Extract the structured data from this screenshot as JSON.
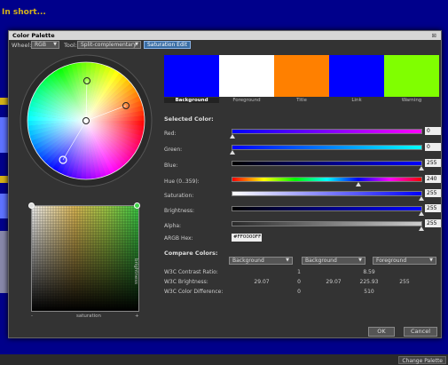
{
  "page": {
    "heading": "In short..."
  },
  "dialog": {
    "title": "Color Palette",
    "close_glyph": "⊠",
    "toolbar": {
      "wheel_label": "Wheel:",
      "wheel_value": "RGB",
      "tool_label": "Tool:",
      "tool_value": "Split-complementary",
      "saturation_edit": "Saturation Edit",
      "combo_arrow": "▼"
    },
    "plane": {
      "x_label": "saturation",
      "y_label": "brightness",
      "minus": "-",
      "plus": "+"
    },
    "swatches": [
      {
        "label": "Background",
        "color": "#0000ff",
        "selected": true
      },
      {
        "label": "Foreground",
        "color": "#ffffff",
        "selected": false
      },
      {
        "label": "Title",
        "color": "#ff8000",
        "selected": false
      },
      {
        "label": "Link",
        "color": "#0000ff",
        "selected": false
      },
      {
        "label": "Warning",
        "color": "#80ff00",
        "selected": false
      }
    ],
    "selected_color": {
      "title": "Selected Color:",
      "red": {
        "label": "Red:",
        "value": "0",
        "level": 0
      },
      "green": {
        "label": "Green:",
        "value": "0",
        "level": 0
      },
      "blue": {
        "label": "Blue:",
        "value": "255",
        "level": 1.0
      },
      "hue": {
        "label": "Hue (0..359):",
        "value": "240",
        "level": 0.667
      },
      "saturation": {
        "label": "Saturation:",
        "value": "255",
        "level": 1.0
      },
      "brightness": {
        "label": "Brightness:",
        "value": "255",
        "level": 1.0
      },
      "alpha": {
        "label": "Alpha:",
        "value": "255",
        "level": 1.0
      },
      "hex": {
        "label": "ARGB Hex:",
        "value": "#FF0000FF"
      }
    },
    "compare": {
      "title": "Compare Colors:",
      "combos": [
        "Background",
        "Background",
        "Foreground"
      ],
      "contrast": {
        "label": "W3C Contrast Ratio:",
        "values": [
          "1",
          "8.59"
        ]
      },
      "brightness": {
        "label": "W3C Brightness:",
        "values": [
          "29.07",
          "0",
          "29.07",
          "225.93",
          "255"
        ]
      },
      "difference": {
        "label": "W3C Color Difference:",
        "values": [
          "0",
          "510"
        ]
      }
    },
    "buttons": {
      "ok": "OK",
      "cancel": "Cancel"
    }
  },
  "footer": {
    "change_palette": "Change Palette"
  }
}
